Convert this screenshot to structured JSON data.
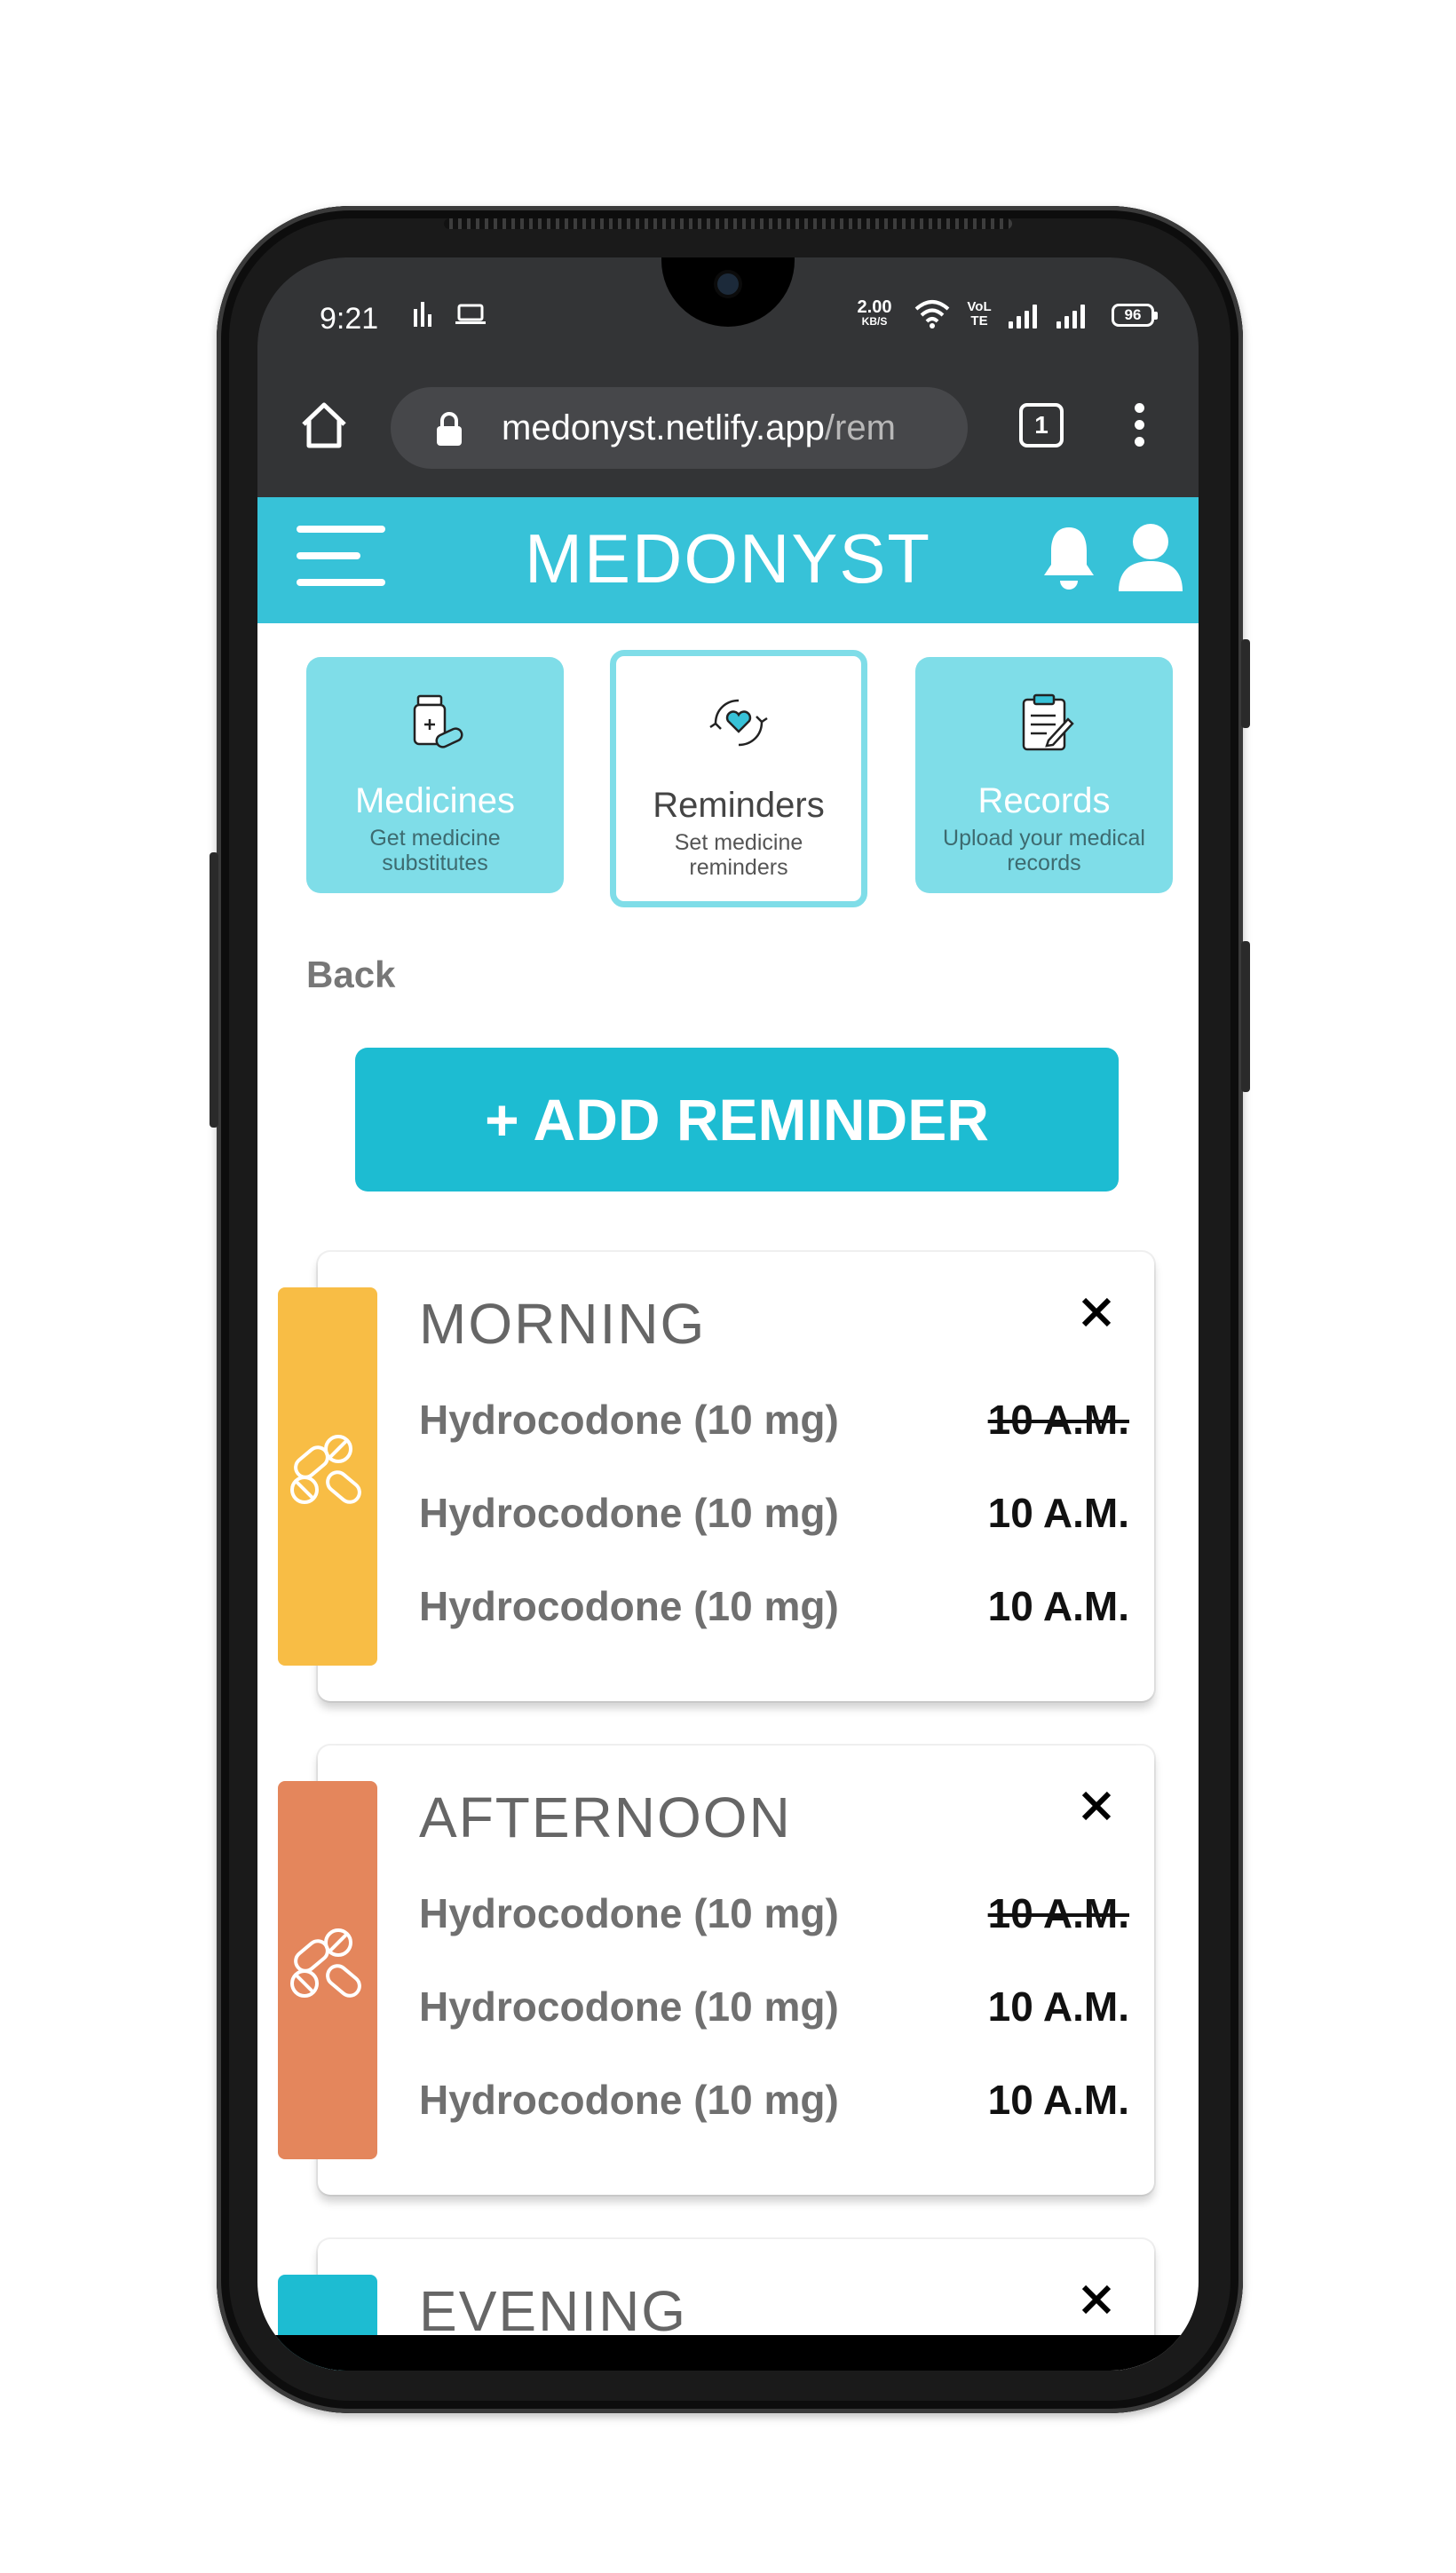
{
  "status_bar": {
    "time": "9:21",
    "net_speed": "2.00",
    "net_speed_unit": "KB/S",
    "volte": "VoLTE",
    "battery": "96"
  },
  "browser": {
    "url_host": "medonyst.netlify.app",
    "url_path": "/rem",
    "tab_count": "1"
  },
  "app": {
    "brand": "MEDONYST",
    "accent_color": "#37c2d8",
    "categories": [
      {
        "title": "Medicines",
        "subtitle": "Get medicine substitutes",
        "icon": "medicine-bottle-icon",
        "active": false
      },
      {
        "title": "Reminders",
        "subtitle": "Set medicine reminders",
        "icon": "reminder-hands-heart-icon",
        "active": true
      },
      {
        "title": "Records",
        "subtitle": "Upload your medical records",
        "icon": "clipboard-icon",
        "active": false
      }
    ],
    "back_label": "Back",
    "add_reminder_label": "+ ADD REMINDER",
    "reminder_groups": [
      {
        "title": "MORNING",
        "color": "#f8bd45",
        "items": [
          {
            "medicine": "Hydrocodone (10 mg)",
            "time": "10 A.M.",
            "taken": true
          },
          {
            "medicine": "Hydrocodone (10 mg)",
            "time": "10 A.M.",
            "taken": false
          },
          {
            "medicine": "Hydrocodone (10 mg)",
            "time": "10 A.M.",
            "taken": false
          }
        ]
      },
      {
        "title": "AFTERNOON",
        "color": "#e4865c",
        "items": [
          {
            "medicine": "Hydrocodone (10 mg)",
            "time": "10 A.M.",
            "taken": true
          },
          {
            "medicine": "Hydrocodone (10 mg)",
            "time": "10 A.M.",
            "taken": false
          },
          {
            "medicine": "Hydrocodone (10 mg)",
            "time": "10 A.M.",
            "taken": false
          }
        ]
      },
      {
        "title": "EVENING",
        "color": "#1dbcd2",
        "items": []
      }
    ]
  }
}
